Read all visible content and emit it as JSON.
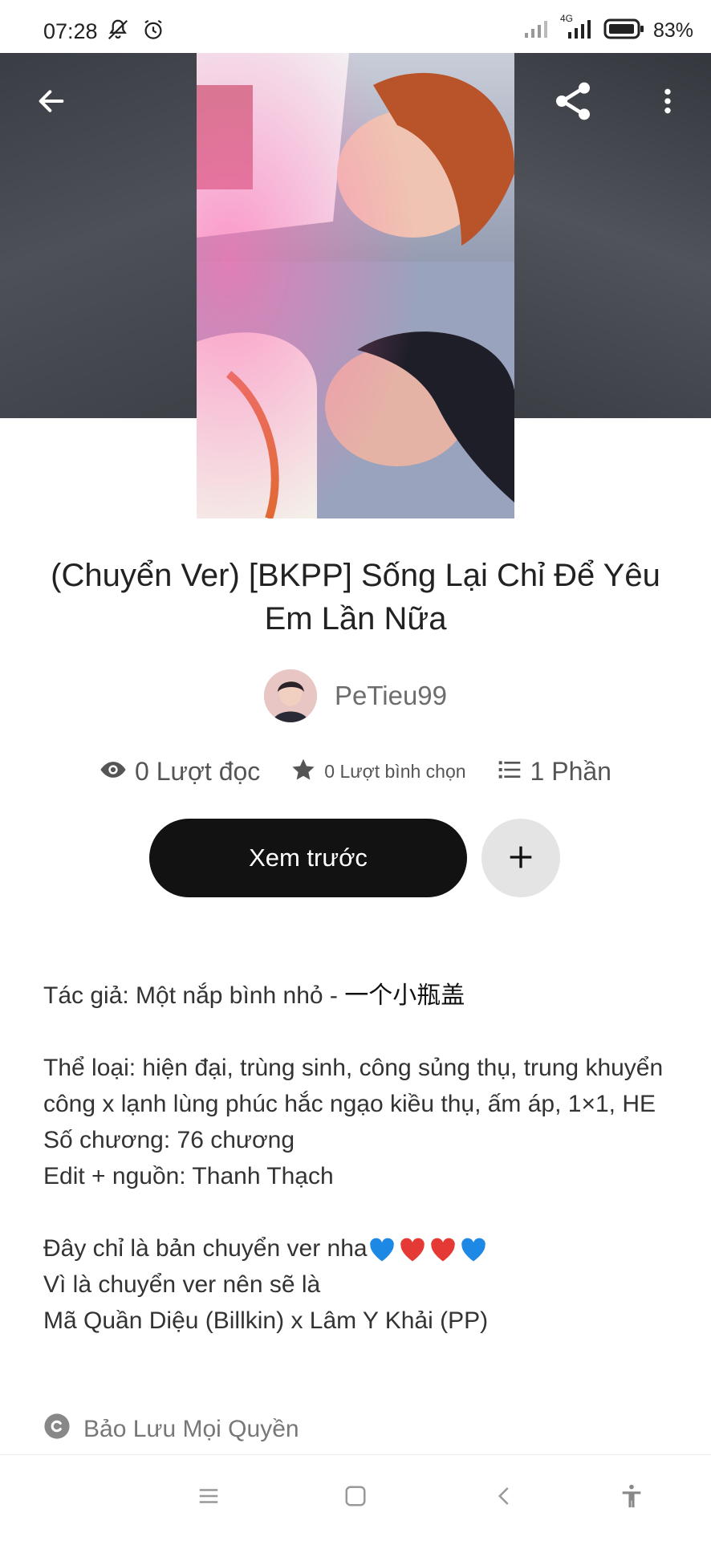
{
  "status_bar": {
    "time": "07:28",
    "battery_percent": "83%",
    "network": "4G",
    "icons": [
      "mute-bell-icon",
      "alarm-icon",
      "signal-icon",
      "battery-icon"
    ]
  },
  "header": {
    "icons": [
      "back-arrow-icon",
      "share-icon",
      "more-vertical-icon"
    ]
  },
  "story": {
    "title": "(Chuyển Ver) [BKPP] Sống Lại Chỉ Để Yêu Em Lần Nữa",
    "author": "PeTieu99",
    "reads": "0 Lượt đọc",
    "votes": "0 Lượt bình chọn",
    "parts": "1 Phần"
  },
  "actions": {
    "preview_label": "Xem trước",
    "add_label": "+"
  },
  "description": {
    "line1_prefix": "Tác giả: Một nắp bình nhỏ - ",
    "line1_cn": "一个小瓶盖",
    "genre": "Thể loại: hiện đại, trùng sinh, công sủng thụ, trung khuyển công x lạnh lùng phúc hắc ngạo kiều thụ, ấm áp, 1×1, HE",
    "chapters": "Số chương: 76 chương",
    "source": "Edit + nguồn: Thanh Thạch",
    "note1": "Đây chỉ là bản chuyển ver nha",
    "note2": "Vì là chuyển ver nên sẽ là",
    "note3": "Mã Quần Diệu (Billkin) x Lâm Y Khải (PP)"
  },
  "copyright": "Bảo Lưu Mọi Quyền",
  "colors": {
    "primary_button": "#121212",
    "add_button": "#e4e4e4",
    "heart_blue": "#1e88e5",
    "heart_red": "#e53935"
  }
}
